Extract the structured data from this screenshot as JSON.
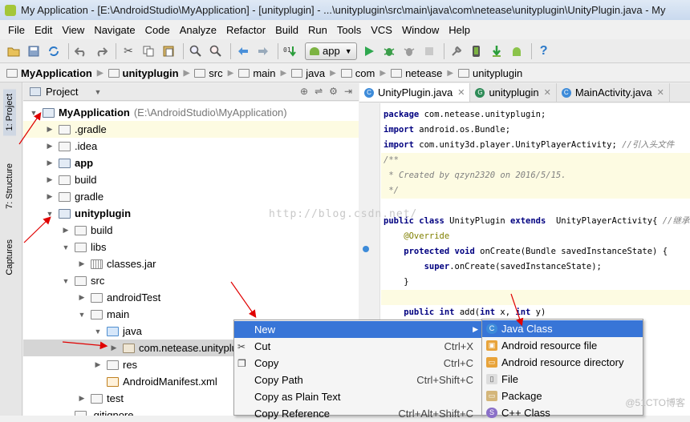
{
  "window": {
    "title": "My Application - [E:\\AndroidStudio\\MyApplication] - [unityplugin] - ...\\unityplugin\\src\\main\\java\\com\\netease\\unityplugin\\UnityPlugin.java - My"
  },
  "menu": [
    "File",
    "Edit",
    "View",
    "Navigate",
    "Code",
    "Analyze",
    "Refactor",
    "Build",
    "Run",
    "Tools",
    "VCS",
    "Window",
    "Help"
  ],
  "toolbar": {
    "run_config": "app",
    "icons": [
      "open-icon",
      "save-icon",
      "sync-icon",
      "undo-icon",
      "redo-icon",
      "cut-icon",
      "copy-icon",
      "paste-icon",
      "find-icon",
      "replace-icon",
      "back-icon",
      "forward-icon",
      "make-icon",
      "run-icon",
      "debug-icon",
      "attach-icon",
      "stop-icon",
      "settings-icon",
      "avd-icon",
      "sdk-icon",
      "android-icon",
      "help-icon"
    ]
  },
  "breadcrumb": [
    "MyApplication",
    "unityplugin",
    "src",
    "main",
    "java",
    "com",
    "netease",
    "unityplugin"
  ],
  "side_tabs": {
    "project": "1: Project",
    "structure": "7: Structure",
    "captures": "Captures"
  },
  "project_panel": {
    "view_label": "Project",
    "tree": [
      {
        "label": "MyApplication",
        "path": "(E:\\AndroidStudio\\MyApplication)",
        "bold": true,
        "depth": 0,
        "open": true,
        "icon": "mod"
      },
      {
        "label": ".gradle",
        "depth": 1,
        "open": false,
        "icon": "folder"
      },
      {
        "label": ".idea",
        "depth": 1,
        "open": false,
        "icon": "folder"
      },
      {
        "label": "app",
        "bold": true,
        "depth": 1,
        "open": false,
        "icon": "mod"
      },
      {
        "label": "build",
        "depth": 1,
        "open": false,
        "icon": "folder"
      },
      {
        "label": "gradle",
        "depth": 1,
        "open": false,
        "icon": "folder"
      },
      {
        "label": "unityplugin",
        "bold": true,
        "depth": 1,
        "open": true,
        "icon": "mod"
      },
      {
        "label": "build",
        "depth": 2,
        "open": false,
        "icon": "folder"
      },
      {
        "label": "libs",
        "depth": 2,
        "open": true,
        "icon": "folder"
      },
      {
        "label": "classes.jar",
        "depth": 3,
        "open": false,
        "icon": "lib"
      },
      {
        "label": "src",
        "depth": 2,
        "open": true,
        "icon": "folder"
      },
      {
        "label": "androidTest",
        "depth": 3,
        "open": false,
        "icon": "folder"
      },
      {
        "label": "main",
        "depth": 3,
        "open": true,
        "icon": "folder"
      },
      {
        "label": "java",
        "depth": 4,
        "open": true,
        "icon": "src"
      },
      {
        "label": "com.netease.unityplu",
        "depth": 5,
        "open": false,
        "icon": "pkg",
        "selected": true
      },
      {
        "label": "res",
        "depth": 4,
        "open": false,
        "icon": "folder"
      },
      {
        "label": "AndroidManifest.xml",
        "depth": 4,
        "leaf": true,
        "icon": "xml"
      },
      {
        "label": "test",
        "depth": 3,
        "open": false,
        "icon": "folder"
      },
      {
        "label": ".gitignore",
        "depth": 2,
        "leaf": true,
        "icon": "file"
      }
    ]
  },
  "editor": {
    "tabs": [
      {
        "label": "UnityPlugin.java",
        "active": true
      },
      {
        "label": "unityplugin",
        "active": false
      },
      {
        "label": "MainActivity.java",
        "active": false
      }
    ],
    "lines": [
      {
        "parts": [
          [
            "kw",
            "package"
          ],
          [
            "",
            " com.netease.unityplugin;"
          ]
        ]
      },
      {
        "parts": [
          [
            "kw",
            "import"
          ],
          [
            "",
            " android.os.Bundle;"
          ]
        ]
      },
      {
        "parts": [
          [
            "kw",
            "import"
          ],
          [
            "",
            " com.unity3d.player.UnityPlayerActivity; "
          ],
          [
            "cm",
            "//引入头文件"
          ]
        ]
      },
      {
        "parts": [
          [
            "cm",
            "/**"
          ]
        ],
        "hl": true
      },
      {
        "parts": [
          [
            "cm",
            " * Created by qzyn2320 on 2016/5/15."
          ]
        ],
        "hl": true
      },
      {
        "parts": [
          [
            "cm",
            " */"
          ]
        ],
        "hl": true
      },
      {
        "parts": [
          [
            "",
            ""
          ]
        ]
      },
      {
        "parts": [
          [
            "kw",
            "public class"
          ],
          [
            "",
            " UnityPlugin "
          ],
          [
            "kw",
            "extends"
          ],
          [
            "",
            "  UnityPlayerActivity{ "
          ],
          [
            "cm",
            "//继承"
          ]
        ]
      },
      {
        "parts": [
          [
            "an",
            "    @Override"
          ]
        ]
      },
      {
        "parts": [
          [
            "kw",
            "    protected void"
          ],
          [
            "",
            " onCreate(Bundle savedInstanceState) {"
          ]
        ]
      },
      {
        "parts": [
          [
            "kw",
            "        super"
          ],
          [
            "",
            ".onCreate(savedInstanceState);"
          ]
        ]
      },
      {
        "parts": [
          [
            "",
            "    }"
          ]
        ]
      },
      {
        "parts": [
          [
            "",
            ""
          ]
        ],
        "hl": true
      },
      {
        "parts": [
          [
            "kw",
            "    public int"
          ],
          [
            "",
            " add("
          ],
          [
            "kw",
            "int"
          ],
          [
            "",
            " x, "
          ],
          [
            "kw",
            "int"
          ],
          [
            "",
            " y)"
          ]
        ]
      }
    ],
    "watermark": "http://blog.csdn.net/"
  },
  "context_menu": {
    "items": [
      {
        "label": "New",
        "shortcut": "",
        "submenu": true,
        "active": true
      },
      {
        "label": "Cut",
        "shortcut": "Ctrl+X",
        "icon": "cut-icon"
      },
      {
        "label": "Copy",
        "shortcut": "Ctrl+C",
        "icon": "copy-icon"
      },
      {
        "label": "Copy Path",
        "shortcut": "Ctrl+Shift+C"
      },
      {
        "label": "Copy as Plain Text",
        "shortcut": ""
      },
      {
        "label": "Copy Reference",
        "shortcut": "Ctrl+Alt+Shift+C"
      }
    ]
  },
  "new_submenu": {
    "items": [
      {
        "label": "Java Class",
        "active": true,
        "icon": "class-icon"
      },
      {
        "label": "Android resource file",
        "icon": "resource-file-icon"
      },
      {
        "label": "Android resource directory",
        "icon": "resource-dir-icon"
      },
      {
        "label": "File",
        "icon": "file-icon"
      },
      {
        "label": "Package",
        "icon": "package-icon"
      },
      {
        "label": "C++ Class",
        "icon": "cpp-class-icon"
      }
    ]
  },
  "watermark_corner": "@51CTO博客",
  "colors": {
    "accent": "#3875d7",
    "highlight": "#fdfbe2",
    "arrow": "#e00000"
  }
}
